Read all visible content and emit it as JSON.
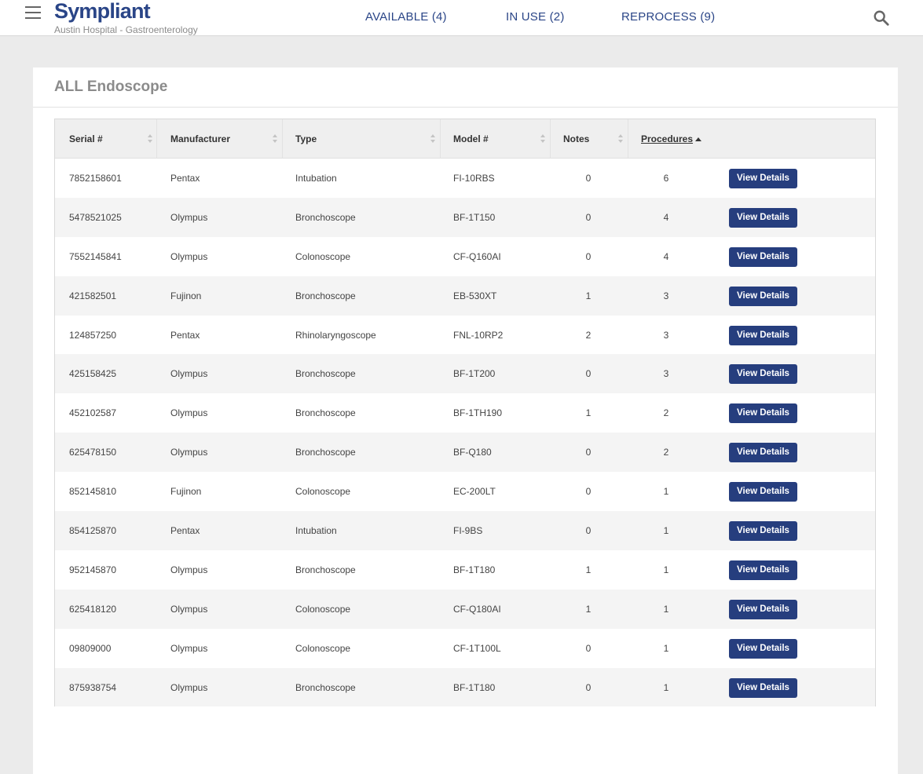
{
  "header": {
    "brand": "Sympliant",
    "subtitle": "Austin Hospital - Gastroenterology",
    "tabs": [
      {
        "label": "AVAILABLE (4)"
      },
      {
        "label": "IN USE (2)"
      },
      {
        "label": "REPROCESS (9)"
      }
    ],
    "accent_color": "#2a4587"
  },
  "card": {
    "title": "ALL Endoscope"
  },
  "table": {
    "columns": [
      "Serial #",
      "Manufacturer",
      "Type",
      "Model #",
      "Notes",
      "Procedures"
    ],
    "sorted_column": "Procedures",
    "sort_direction": "ascending-indicator",
    "action_label": "View Details",
    "button_color": "#263e7e",
    "rows": [
      {
        "serial": "7852158601",
        "manufacturer": "Pentax",
        "type": "Intubation",
        "model": "FI-10RBS",
        "notes": "0",
        "procedures": "6"
      },
      {
        "serial": "5478521025",
        "manufacturer": "Olympus",
        "type": "Bronchoscope",
        "model": "BF-1T150",
        "notes": "0",
        "procedures": "4"
      },
      {
        "serial": "7552145841",
        "manufacturer": "Olympus",
        "type": "Colonoscope",
        "model": "CF-Q160AI",
        "notes": "0",
        "procedures": "4"
      },
      {
        "serial": "421582501",
        "manufacturer": "Fujinon",
        "type": "Bronchoscope",
        "model": "EB-530XT",
        "notes": "1",
        "procedures": "3"
      },
      {
        "serial": "124857250",
        "manufacturer": "Pentax",
        "type": "Rhinolaryngoscope",
        "model": "FNL-10RP2",
        "notes": "2",
        "procedures": "3"
      },
      {
        "serial": "425158425",
        "manufacturer": "Olympus",
        "type": "Bronchoscope",
        "model": "BF-1T200",
        "notes": "0",
        "procedures": "3"
      },
      {
        "serial": "452102587",
        "manufacturer": "Olympus",
        "type": "Bronchoscope",
        "model": "BF-1TH190",
        "notes": "1",
        "procedures": "2"
      },
      {
        "serial": "625478150",
        "manufacturer": "Olympus",
        "type": "Bronchoscope",
        "model": "BF-Q180",
        "notes": "0",
        "procedures": "2"
      },
      {
        "serial": "852145810",
        "manufacturer": "Fujinon",
        "type": "Colonoscope",
        "model": "EC-200LT",
        "notes": "0",
        "procedures": "1"
      },
      {
        "serial": "854125870",
        "manufacturer": "Pentax",
        "type": "Intubation",
        "model": "FI-9BS",
        "notes": "0",
        "procedures": "1"
      },
      {
        "serial": "952145870",
        "manufacturer": "Olympus",
        "type": "Bronchoscope",
        "model": "BF-1T180",
        "notes": "1",
        "procedures": "1"
      },
      {
        "serial": "625418120",
        "manufacturer": "Olympus",
        "type": "Colonoscope",
        "model": "CF-Q180AI",
        "notes": "1",
        "procedures": "1"
      },
      {
        "serial": "09809000",
        "manufacturer": "Olympus",
        "type": "Colonoscope",
        "model": "CF-1T100L",
        "notes": "0",
        "procedures": "1"
      },
      {
        "serial": "875938754",
        "manufacturer": "Olympus",
        "type": "Bronchoscope",
        "model": "BF-1T180",
        "notes": "0",
        "procedures": "1"
      }
    ]
  }
}
